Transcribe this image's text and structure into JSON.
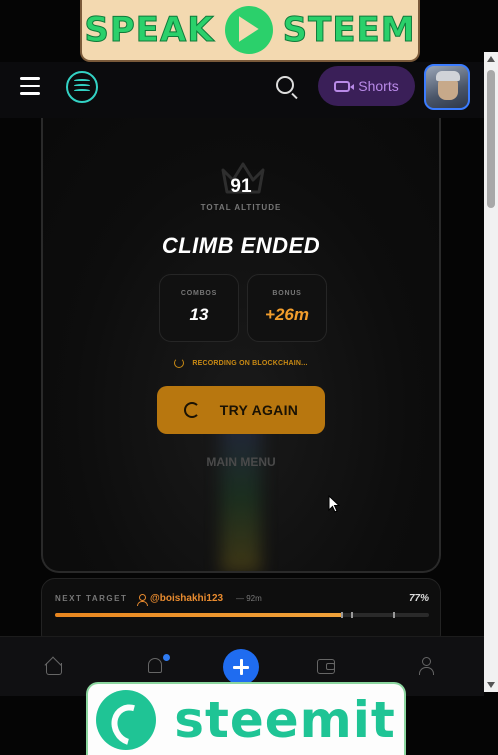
{
  "banner_top": {
    "left_word": "SPEAK",
    "right_word": "STEEM"
  },
  "header": {
    "shorts_label": "Shorts"
  },
  "game": {
    "altitude_value": "91",
    "altitude_label": "TOTAL ALTITUDE",
    "title": "CLIMB ENDED",
    "stats": [
      {
        "key": "COMBOS",
        "value": "13",
        "color": "#ffffff"
      },
      {
        "key": "BONUS",
        "value": "+26m",
        "color": "#f29d2c"
      }
    ],
    "recording_text": "RECORDING ON BLOCKCHAIN...",
    "try_again_label": "TRY AGAIN",
    "main_menu_label": "MAIN MENU"
  },
  "next_target": {
    "label": "NEXT TARGET",
    "user": "@boishakhi123",
    "distance": "— 92m",
    "percent": "77%",
    "progress": 0.77
  },
  "banner_bottom": {
    "word": "steemit"
  },
  "colors": {
    "accent_orange": "#b8770f",
    "shorts_purple": "#3a1f58",
    "nav_blue": "#1f6cf0",
    "teal": "#33d2c4"
  }
}
